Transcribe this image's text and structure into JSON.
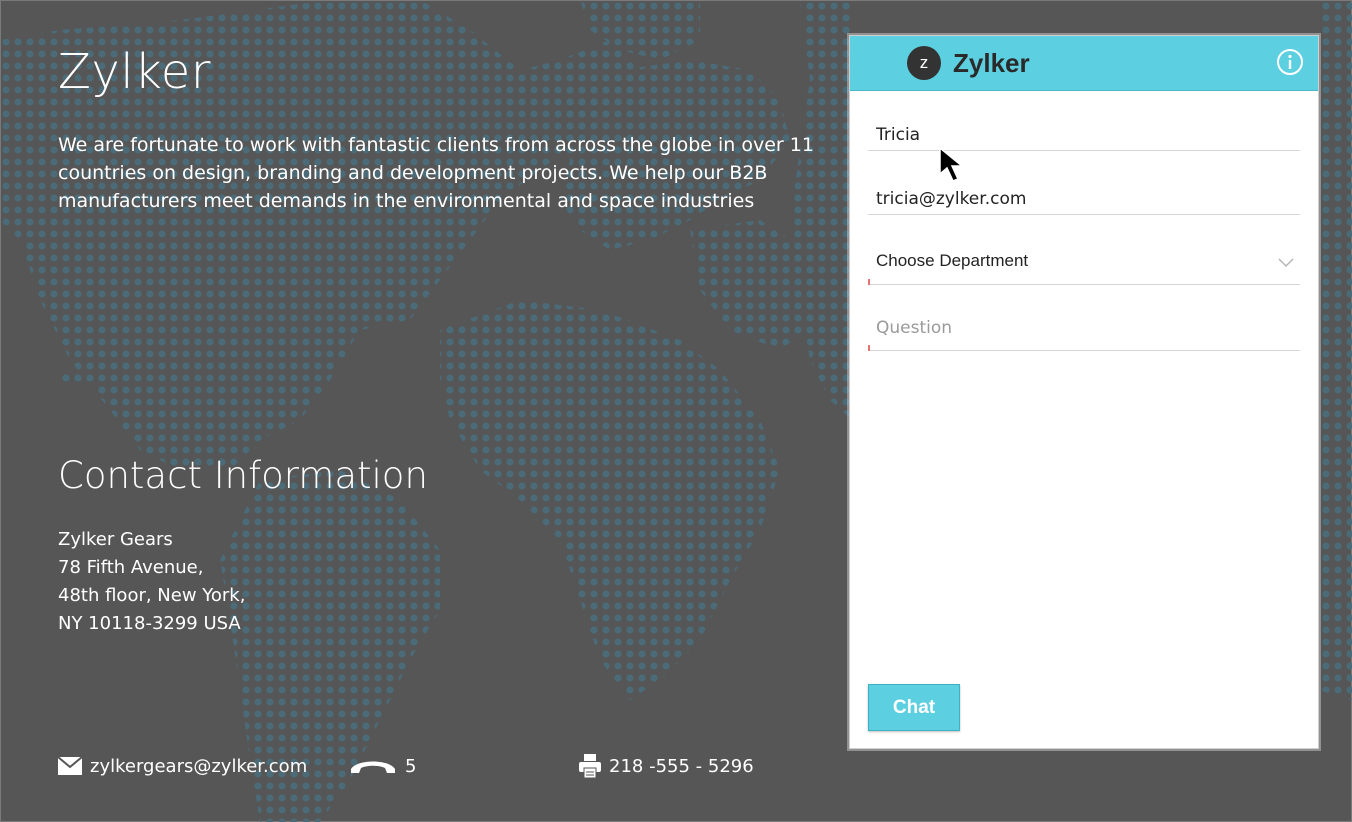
{
  "page": {
    "brand": "Zylker",
    "intro": "We are fortunate to work with fantastic clients from across the globe in over 11 countries on design, branding and development projects. We help our B2B manufacturers meet demands in the environmental and space industries",
    "contact_title": "Contact Information",
    "address": [
      "Zylker Gears",
      "78 Fifth Avenue,",
      "48th floor, New York,",
      "NY 10118-3299 USA"
    ],
    "email": "zylkergears@zylker.com",
    "phone": "5",
    "fax": "218 -555 - 5296",
    "icons": {
      "email": "envelope-icon",
      "phone": "phone-icon",
      "fax": "printer-icon"
    }
  },
  "widget": {
    "logo_letter": "z",
    "title": "Zylker",
    "info_icon": "info-icon",
    "name_value": "Tricia",
    "email_value": "tricia@zylker.com",
    "department_value": "Choose Department",
    "question_placeholder": "Question",
    "chat_label": "Chat"
  },
  "colors": {
    "background": "#565656",
    "accent": "#5ccfe0",
    "map_dots": "#4a6a78",
    "required_marker": "#e57373"
  }
}
